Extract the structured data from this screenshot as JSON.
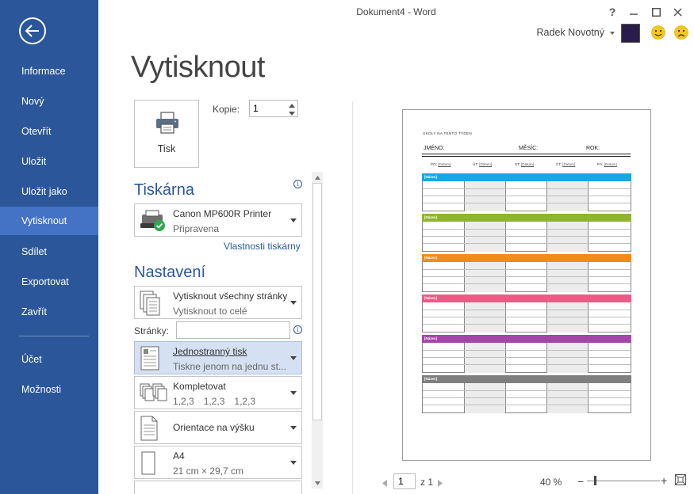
{
  "window": {
    "title": "Dokument4 - Word"
  },
  "account": {
    "user_name": "Radek Novotný"
  },
  "sidebar": {
    "items": [
      {
        "label": "Informace"
      },
      {
        "label": "Nový"
      },
      {
        "label": "Otevřít"
      },
      {
        "label": "Uložit"
      },
      {
        "label": "Uložit jako"
      },
      {
        "label": "Vytisknout",
        "active": true
      },
      {
        "label": "Sdílet"
      },
      {
        "label": "Exportovat"
      },
      {
        "label": "Zavřít"
      },
      {
        "label": "Účet"
      },
      {
        "label": "Možnosti"
      }
    ]
  },
  "print": {
    "page_title": "Vytisknout",
    "print_button": "Tisk",
    "copies_label": "Kopie:",
    "copies_value": "1",
    "printer_heading": "Tiskárna",
    "printer_name": "Canon MP600R Printer",
    "printer_status": "Připravena",
    "printer_properties": "Vlastnosti tiskárny",
    "settings_heading": "Nastavení",
    "pages_label": "Stránky:",
    "pages_value": "",
    "settings": [
      {
        "title": "Vytisknout všechny stránky",
        "subtitle": "Vytisknout to celé"
      },
      {
        "title": "Jednostranný tisk",
        "subtitle": "Tiskne jenom na jednu st..."
      },
      {
        "title": "Kompletovat",
        "subtitle_parts": [
          "1,2,3",
          "1,2,3",
          "1,2,3"
        ]
      },
      {
        "title": "Orientace na výšku"
      },
      {
        "title": "A4",
        "subtitle": "21 cm × 29,7 cm"
      }
    ]
  },
  "preview": {
    "heading": "ÚKOLY NA TENTO TÝDEN",
    "name_label": "JMÉNO:",
    "month_label": "MĚSÍC:",
    "year_label": "ROK:",
    "days": [
      {
        "day": "PO:",
        "date": "[Datum]"
      },
      {
        "day": "ÚT:",
        "date": "[Datum]"
      },
      {
        "day": "ST:",
        "date": "[Datum]"
      },
      {
        "day": "ČT:",
        "date": "[Datum]"
      },
      {
        "day": "PÁ:",
        "date": "[Datum]"
      }
    ],
    "blocks": [
      {
        "label": "[Název]",
        "color": "#1aa6df"
      },
      {
        "label": "[Název]",
        "color": "#8fb431"
      },
      {
        "label": "[Název]",
        "color": "#f28a1c"
      },
      {
        "label": "[Název]",
        "color": "#ec5b86"
      },
      {
        "label": "[Název]",
        "color": "#a446a7"
      },
      {
        "label": "[Název]",
        "color": "#7f7f7f"
      }
    ]
  },
  "footer": {
    "current_page": "1",
    "of_pages": "z 1",
    "zoom": "40 %"
  },
  "colors": {
    "accent": "#2b579a",
    "sidebar_active": "#4472c4"
  }
}
